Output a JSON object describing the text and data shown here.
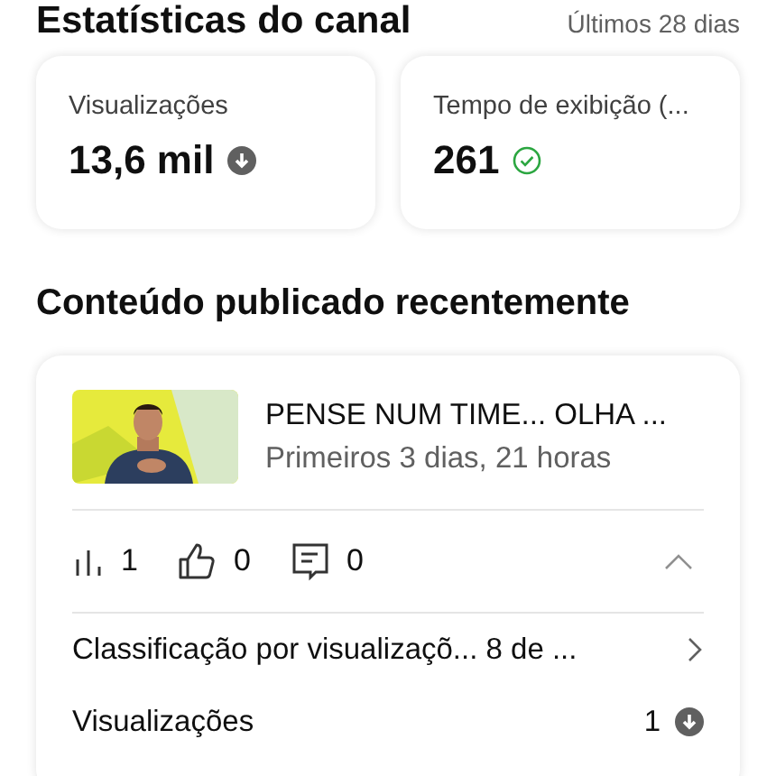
{
  "header": {
    "title": "Estatísticas do canal",
    "period": "Últimos 28 dias"
  },
  "stat_cards": [
    {
      "label": "Visualizações",
      "value": "13,6 mil",
      "declined": true
    },
    {
      "label": "Tempo de exibição (...",
      "value": "261",
      "declined": false
    }
  ],
  "recent": {
    "title": "Conteúdo publicado recentemente",
    "video": {
      "title": "PENSE NUM TIME... OLHA ...",
      "subtitle": "Primeiros 3 dias, 21 horas",
      "metrics": [
        {
          "kind": "views",
          "value": "1"
        },
        {
          "kind": "likes",
          "value": "0"
        },
        {
          "kind": "comments",
          "value": "0"
        }
      ],
      "expanded": true,
      "rows": [
        {
          "label": "Classificação por visualizaçõ... 8 de ...",
          "kind": "link"
        },
        {
          "label": "Visualizações",
          "value": "1",
          "kind": "value",
          "declined": true
        }
      ]
    }
  }
}
